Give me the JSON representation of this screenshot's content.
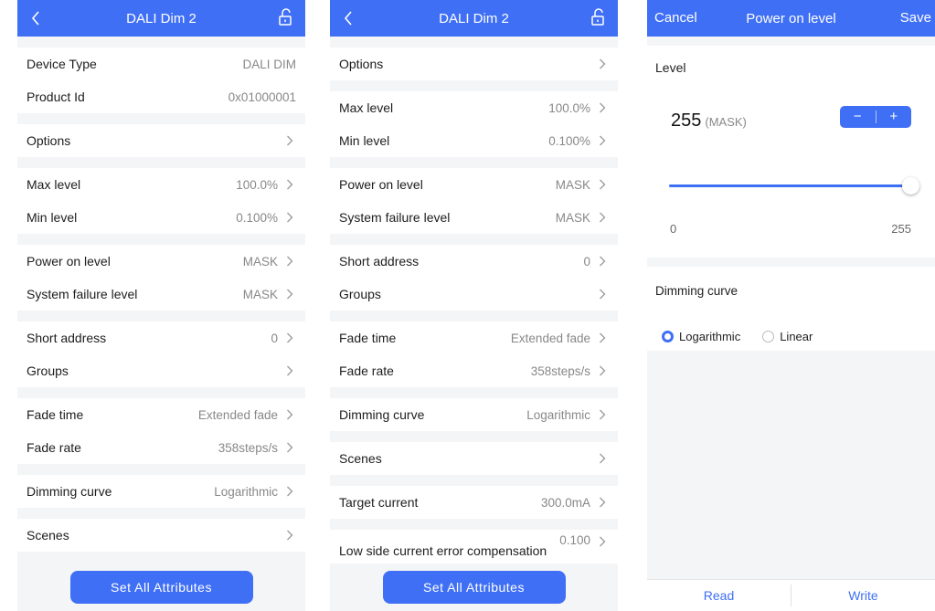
{
  "colors": {
    "accent": "#3f6ff5",
    "background": "#f4f5f7",
    "muted_text": "#888888"
  },
  "screen1": {
    "title": "DALI Dim 2",
    "groups": [
      [
        {
          "label": "Device Type",
          "value": "DALI DIM",
          "chevron": false
        },
        {
          "label": "Product Id",
          "value": "0x01000001",
          "chevron": false
        }
      ],
      [
        {
          "label": "Options",
          "value": "",
          "chevron": true
        }
      ],
      [
        {
          "label": "Max level",
          "value": "100.0%",
          "chevron": true
        },
        {
          "label": "Min level",
          "value": "0.100%",
          "chevron": true
        }
      ],
      [
        {
          "label": "Power on level",
          "value": "MASK",
          "chevron": true
        },
        {
          "label": "System failure level",
          "value": "MASK",
          "chevron": true
        }
      ],
      [
        {
          "label": "Short address",
          "value": "0",
          "chevron": true
        },
        {
          "label": "Groups",
          "value": "",
          "chevron": true
        }
      ],
      [
        {
          "label": "Fade time",
          "value": "Extended fade",
          "chevron": true
        },
        {
          "label": "Fade rate",
          "value": "358steps/s",
          "chevron": true
        }
      ],
      [
        {
          "label": "Dimming curve",
          "value": "Logarithmic",
          "chevron": true
        }
      ],
      [
        {
          "label": "Scenes",
          "value": "",
          "chevron": true
        }
      ]
    ],
    "button_label": "Set All Attributes"
  },
  "screen2": {
    "title": "DALI Dim 2",
    "groups": [
      [
        {
          "label": "Options",
          "value": "",
          "chevron": true
        }
      ],
      [
        {
          "label": "Max level",
          "value": "100.0%",
          "chevron": true
        },
        {
          "label": "Min level",
          "value": "0.100%",
          "chevron": true
        }
      ],
      [
        {
          "label": "Power on level",
          "value": "MASK",
          "chevron": true
        },
        {
          "label": "System failure level",
          "value": "MASK",
          "chevron": true
        }
      ],
      [
        {
          "label": "Short address",
          "value": "0",
          "chevron": true
        },
        {
          "label": "Groups",
          "value": "",
          "chevron": true
        }
      ],
      [
        {
          "label": "Fade time",
          "value": "Extended fade",
          "chevron": true
        },
        {
          "label": "Fade rate",
          "value": "358steps/s",
          "chevron": true
        }
      ],
      [
        {
          "label": "Dimming curve",
          "value": "Logarithmic",
          "chevron": true
        }
      ],
      [
        {
          "label": "Scenes",
          "value": "",
          "chevron": true
        }
      ],
      [
        {
          "label": "Target current",
          "value": "300.0mA",
          "chevron": true
        }
      ],
      [
        {
          "label": "Low side current error compensation",
          "value": "0.100",
          "chevron": true,
          "tall": true
        }
      ]
    ],
    "button_label": "Set All Attributes"
  },
  "screen3": {
    "cancel_label": "Cancel",
    "title": "Power on level",
    "save_label": "Save",
    "level_title": "Level",
    "level_value": "255",
    "level_note": "(MASK)",
    "stepper_minus": "−",
    "stepper_plus": "+",
    "slider_fraction": 1.0,
    "slider_min": "0",
    "slider_max": "255",
    "curve_title": "Dimming curve",
    "curve_options": [
      {
        "label": "Logarithmic",
        "selected": true
      },
      {
        "label": "Linear",
        "selected": false
      }
    ],
    "read_label": "Read",
    "write_label": "Write"
  }
}
